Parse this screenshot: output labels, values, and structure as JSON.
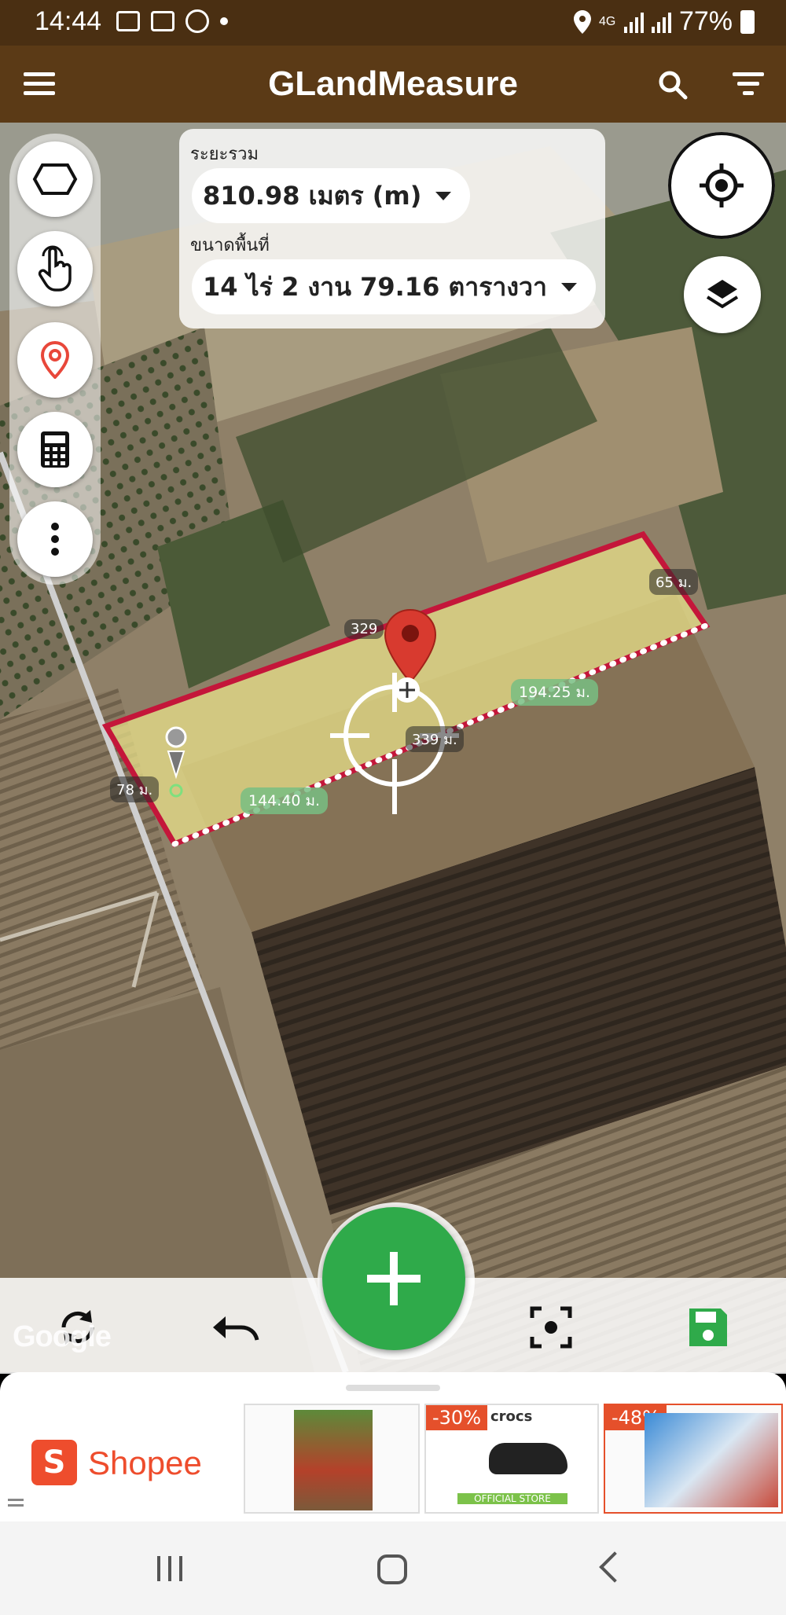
{
  "status_bar": {
    "time": "14:44",
    "network": "4G",
    "battery": "77%"
  },
  "app_bar": {
    "title": "GLandMeasure",
    "menu_icon": "hamburger-icon",
    "search_icon": "search-icon",
    "filter_icon": "filter-icon"
  },
  "info_panel": {
    "distance_label": "ระยะรวม",
    "distance_value": "810.98 เมตร (m)",
    "area_label": "ขนาดพื้นที่",
    "area_value": "14 ไร่ 2 งาน 79.16 ตารางวา"
  },
  "map": {
    "side_labels": {
      "top_right": "65 ม.",
      "left": "78 ม.",
      "right_segment": "194.25 ม.",
      "left_segment": "144.40 ม.",
      "top_marker": "329",
      "mid_marker": "339 ม."
    },
    "attribution": "Google",
    "colors": {
      "polygon_stroke": "#c4163a",
      "polygon_fill": "#e8e08a",
      "accent_green": "#2faa4a",
      "appbar_brown": "#5b3a16"
    }
  },
  "tools": {
    "polygon": "polygon-icon",
    "touch": "touch-icon",
    "pin": "location-pin-icon",
    "calculator": "calculator-icon",
    "more": "more-vertical-icon"
  },
  "toolbar": {
    "refresh": "refresh-icon",
    "undo": "undo-icon",
    "add": "add-icon",
    "focus": "focus-icon",
    "save": "save-icon"
  },
  "ads": {
    "shopee_text": "Shopee",
    "ad2_discount": "",
    "ad3_discount": "-30%",
    "ad3_brand": "crocs",
    "ad3_tag": "OFFICIAL STORE",
    "ad4_discount": "-48%"
  }
}
